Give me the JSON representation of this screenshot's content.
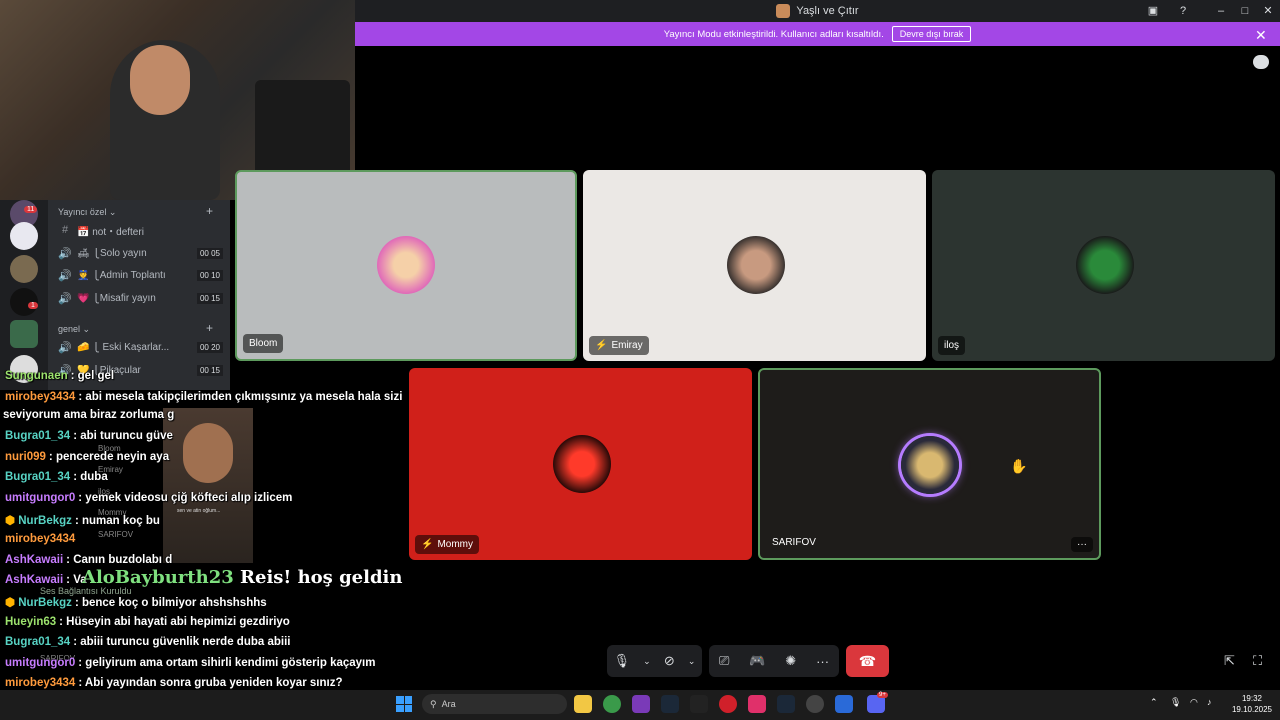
{
  "window": {
    "title": "Yaşlı ve Çıtır",
    "controls": [
      "inbox-icon",
      "help-icon",
      "minimize-icon",
      "maximize-icon",
      "close-icon"
    ]
  },
  "banner": {
    "message": "Yayıncı Modu etkinleştirildi. Kullanıcı adları kısaltıldı.",
    "button_label": "Devre dışı bırak",
    "color": "#a347e6"
  },
  "sidebar": {
    "guild_badge": "11",
    "guild_badge2": "1",
    "categories": [
      {
        "label": "Yayıncı özel ⌄"
      },
      {
        "label": "genel ⌄"
      }
    ],
    "channels": [
      {
        "icon": "#",
        "label": "📅 not・defteri",
        "count": ""
      },
      {
        "icon": "🔊",
        "label": "🛋 ⎩Solo yayın",
        "count": "00 05"
      },
      {
        "icon": "🔊",
        "label": "👮 ⎩Admin Toplantı",
        "count": "00 10"
      },
      {
        "icon": "🔊",
        "label": "💗 ⎩Misafir yayın",
        "count": "00 15"
      },
      {
        "icon": "🔊",
        "label": "🧀 ⎩ Eski Kaşarlar...",
        "count": "00 20"
      },
      {
        "icon": "🔊",
        "label": "💛 ⎩Pikaçular",
        "count": "00 15"
      }
    ],
    "voice_status": "Ses Bağlantısı Kuruldu",
    "user": "SARIFOV",
    "voice_members": [
      "Bloom",
      "Emiray",
      "iloş",
      "Mommy",
      "SARIFOV"
    ]
  },
  "tiles": [
    {
      "name": "Bloom",
      "bg": "#b9bcbd",
      "muted": false
    },
    {
      "name": "Emiray",
      "bg": "#ebe8e5",
      "muted": true
    },
    {
      "name": "iloş",
      "bg": "#2c3430",
      "muted": false
    },
    {
      "name": "Mommy",
      "bg": "#d0201a",
      "muted": true
    },
    {
      "name": "SARIFOV",
      "bg": "#1e1c1a",
      "muted": false,
      "more": "···"
    }
  ],
  "controls": {
    "mic": "mic-icon",
    "camera": "camera-off-icon",
    "screen": "screenshare-icon",
    "activity": "gamepad-icon",
    "soundboard": "soundboard-icon",
    "more": "···",
    "hangup": "hangup-icon"
  },
  "chat": [
    {
      "user": "Sungunaen",
      "color": "#9de36e",
      "text": ": gel gel"
    },
    {
      "user": "mirobey3434",
      "color": "#ff9b3d",
      "text": ": abi mesela takipçilerimden çıkmışsınız ya mesela hala sizi"
    },
    {
      "user": "",
      "color": "#ffffff",
      "text": "seviyorum ama biraz zorluma g"
    },
    {
      "user": "Bugra01_34",
      "color": "#58d3c4",
      "text": ": abi turuncu güve"
    },
    {
      "user": "nuri099",
      "color": "#ff9b3d",
      "text": ": pencerede neyin aya"
    },
    {
      "user": "Bugra01_34",
      "color": "#58d3c4",
      "text": ": duba"
    },
    {
      "user": "umitgungor0",
      "color": "#c77dff",
      "text": ": yemek videosu                                 çiğ köfteci alıp izlicem"
    },
    {
      "user": "NurBekgz",
      "color": "#58d3c4",
      "text": ": numan koç bu"
    },
    {
      "user": "mirobey3434",
      "color": "#ff9b3d",
      "text": ""
    },
    {
      "user": "AshKawaii",
      "color": "#c77dff",
      "text": ": Canın buzdolabı d"
    },
    {
      "user": "AshKawaii",
      "color": "#c77dff",
      "text": ": Va"
    },
    {
      "user": "NurBekgz",
      "color": "#58d3c4",
      "text": ": bence koç o bilmiyor ahshshshhs"
    },
    {
      "user": "Hueyin63",
      "color": "#9de36e",
      "text": ": Hüseyin abi hayati abi hepimizi gezdiriyo"
    },
    {
      "user": "Bugra01_34",
      "color": "#58d3c4",
      "text": ": abiii turuncu güvenlik nerde duba abiii"
    },
    {
      "user": "umitgungor0",
      "color": "#c77dff",
      "text": ": geliyirum ama ortam sihirli kendimi gösterip kaçayım"
    },
    {
      "user": "mirobey3434",
      "color": "#ff9b3d",
      "text": ": Abi yayından sonra gruba yeniden koyar sınız?"
    }
  ],
  "welcome": {
    "user": "AloBayburth23",
    "text": " Reis! hoş geldin"
  },
  "clip_caption": "sen ve atin oğlum...",
  "taskbar": {
    "search_label": "Ara",
    "time": "19:32",
    "date": "19.10.2025",
    "discord_badge": "9+"
  }
}
